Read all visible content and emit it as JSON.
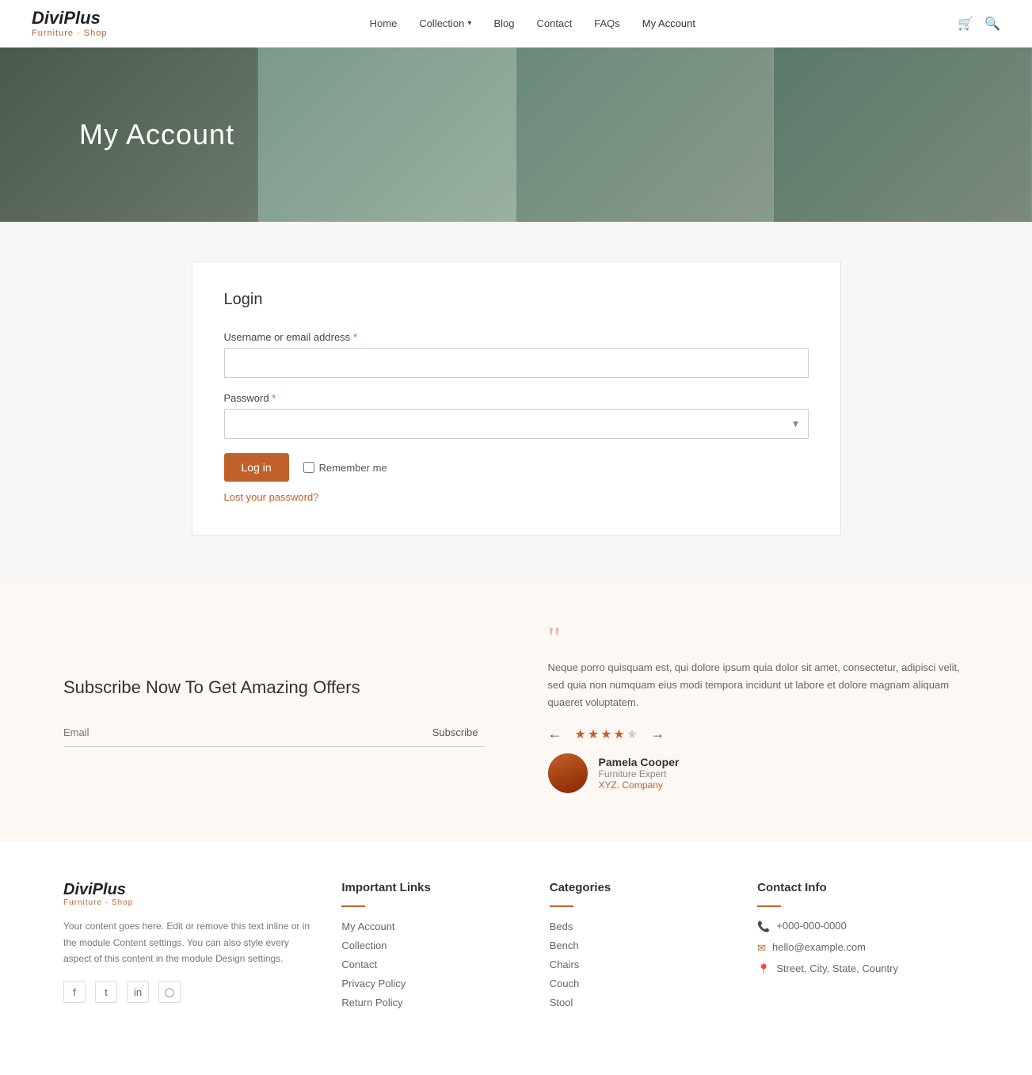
{
  "header": {
    "logo": {
      "text": "DiviPlus",
      "sub": "Furniture · Shop"
    },
    "nav": [
      {
        "label": "Home",
        "id": "home"
      },
      {
        "label": "Collection",
        "id": "collection",
        "hasDropdown": true
      },
      {
        "label": "Blog",
        "id": "blog"
      },
      {
        "label": "Contact",
        "id": "contact"
      },
      {
        "label": "FAQs",
        "id": "faqs"
      },
      {
        "label": "My Account",
        "id": "my-account",
        "active": true
      }
    ]
  },
  "hero": {
    "title": "My Account"
  },
  "login": {
    "title": "Login",
    "username_label": "Username or email address",
    "username_required": "*",
    "password_label": "Password",
    "password_required": "*",
    "login_button": "Log in",
    "remember_label": "Remember me",
    "lost_password": "Lost your password?"
  },
  "subscribe": {
    "title": "Subscribe Now To Get Amazing Offers",
    "email_placeholder": "Email",
    "button_label": "Subscribe"
  },
  "testimonial": {
    "text": "Neque porro quisquam est, qui dolore ipsum quia dolor sit amet, consectetur, adipisci velit, sed quia non numquam eius modi tempora incidunt ut labore et dolore magnam aliquam quaeret voluptatem.",
    "stars": 4,
    "total_stars": 5,
    "author_name": "Pamela Cooper",
    "author_role": "Furniture Expert",
    "author_company": "XYZ. Company"
  },
  "footer": {
    "logo": {
      "text": "DiviPlus",
      "sub": "Furniture · Shop"
    },
    "description": "Your content goes here. Edit or remove this text inline or in the module Content settings. You can also style every aspect of this content in the module Design settings.",
    "socials": [
      {
        "icon": "f",
        "name": "facebook",
        "label": "Facebook"
      },
      {
        "icon": "t",
        "name": "twitter",
        "label": "Twitter"
      },
      {
        "icon": "in",
        "name": "linkedin",
        "label": "LinkedIn"
      },
      {
        "icon": "ig",
        "name": "instagram",
        "label": "Instagram"
      }
    ],
    "important_links": {
      "title": "Important Links",
      "links": [
        {
          "label": "My Account",
          "id": "my-account"
        },
        {
          "label": "Collection",
          "id": "collection"
        },
        {
          "label": "Contact",
          "id": "contact"
        },
        {
          "label": "Privacy Policy",
          "id": "privacy"
        },
        {
          "label": "Return Policy",
          "id": "return"
        }
      ]
    },
    "categories": {
      "title": "Categories",
      "links": [
        {
          "label": "Beds",
          "id": "beds"
        },
        {
          "label": "Bench",
          "id": "bench"
        },
        {
          "label": "Chairs",
          "id": "chairs"
        },
        {
          "label": "Couch",
          "id": "couch"
        },
        {
          "label": "Stool",
          "id": "stool"
        }
      ]
    },
    "contact_info": {
      "title": "Contact Info",
      "phone": "+000-000-0000",
      "email": "hello@example.com",
      "address": "Street, City, State, Country"
    }
  }
}
